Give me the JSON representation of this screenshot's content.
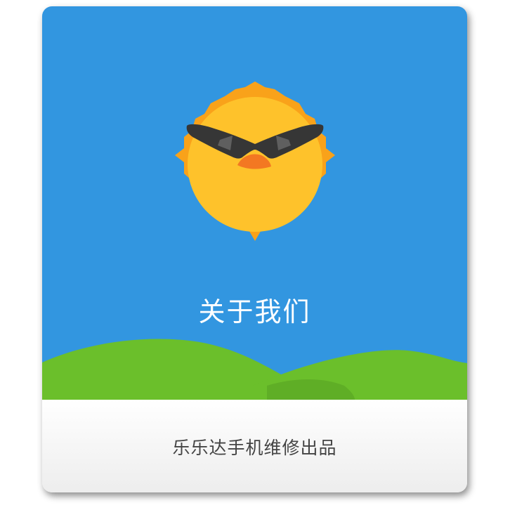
{
  "about": {
    "title": "关于我们",
    "credit": "乐乐达手机维修出品"
  },
  "illustration": {
    "icon": "sun-with-sunglasses-icon",
    "sky_color": "#3296e0",
    "hill_color": "#6bbf2b",
    "sun_color": "#fec22b",
    "ray_color": "#f9a21a"
  }
}
